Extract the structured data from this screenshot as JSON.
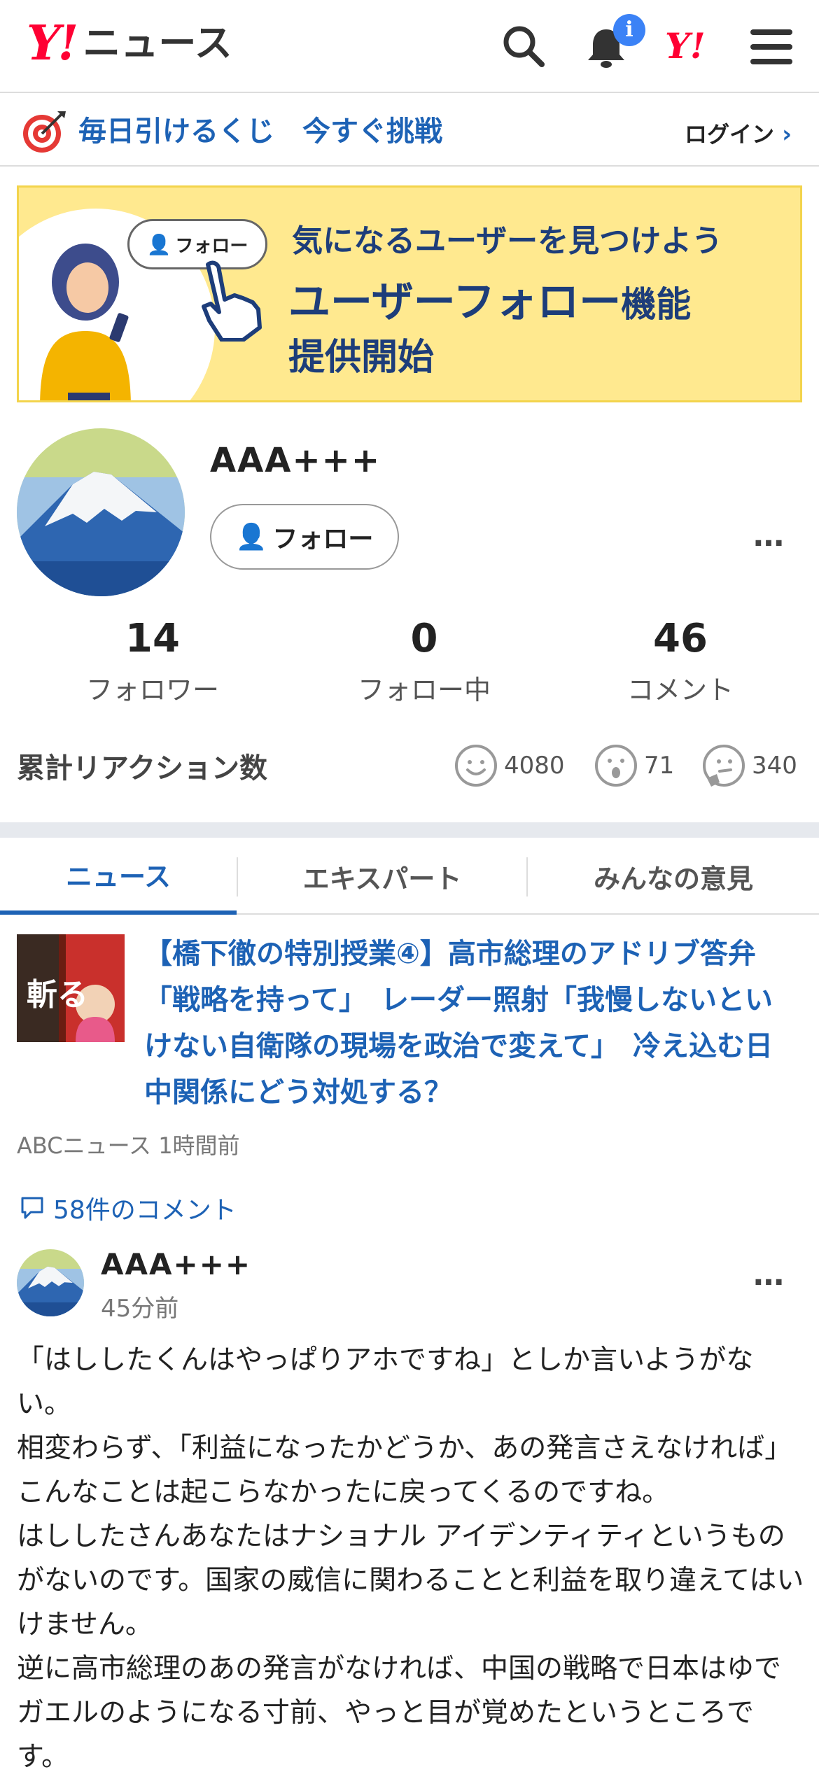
{
  "header": {
    "logo_mark": "Y!",
    "logo_text": "ニュース",
    "notification_badge": "i",
    "yahoo_mark": "Y!"
  },
  "campaign": {
    "text": "毎日引けるくじ　今すぐ挑戦",
    "login_label": "ログイン"
  },
  "banner": {
    "follow_chip": "フォロー",
    "line1": "気になるユーザーを見つけよう",
    "line2_main": "ユーザーフォロー",
    "line2_suffix": "機能",
    "line3": "提供開始"
  },
  "profile": {
    "username": "AAA+++",
    "follow_button": "フォロー",
    "more": "…",
    "stats": [
      {
        "value": "14",
        "label": "フォロワー"
      },
      {
        "value": "0",
        "label": "フォロー中"
      },
      {
        "value": "46",
        "label": "コメント"
      }
    ],
    "reaction_title": "累計リアクション数",
    "reactions": [
      {
        "icon": "smile-icon",
        "count": "4080"
      },
      {
        "icon": "surprised-icon",
        "count": "71"
      },
      {
        "icon": "thinking-icon",
        "count": "340"
      }
    ]
  },
  "tabs": [
    {
      "label": "ニュース",
      "active": true
    },
    {
      "label": "エキスパート",
      "active": false
    },
    {
      "label": "みんなの意見",
      "active": false
    }
  ],
  "article": {
    "title": "【橋下徹の特別授業④】高市総理のアドリブ答弁「戦略を持って」　レーダー照射「我慢しないといけない自衛隊の現場を政治で変えて」　冷え込む日中関係にどう対処する？",
    "meta": "ABCニュース 1時間前",
    "comments_link": "58件のコメント",
    "thumb_text": "斬る"
  },
  "comment": {
    "username": "AAA+++",
    "time": "45分前",
    "more": "…",
    "paragraphs": [
      "「はししたくんはやっぱりアホですね」としか言いようがない。",
      "相変わらず、「利益になったかどうか、あの発言さえなければ」こんなことは起こらなかったに戻ってくるのですね。",
      "はししたさんあなたはナショナル アイデンティティというものがないのです。国家の威信に関わることと利益を取り違えてはいけません。",
      "逆に高市総理のあの発言がなければ、中国の戦略で日本はゆでガエルのようになる寸前、やっと目が覚めたというところです。"
    ]
  },
  "colors": {
    "accent_blue": "#1d62b5",
    "yahoo_red": "#ff0033",
    "banner_yellow": "#ffe98f"
  }
}
